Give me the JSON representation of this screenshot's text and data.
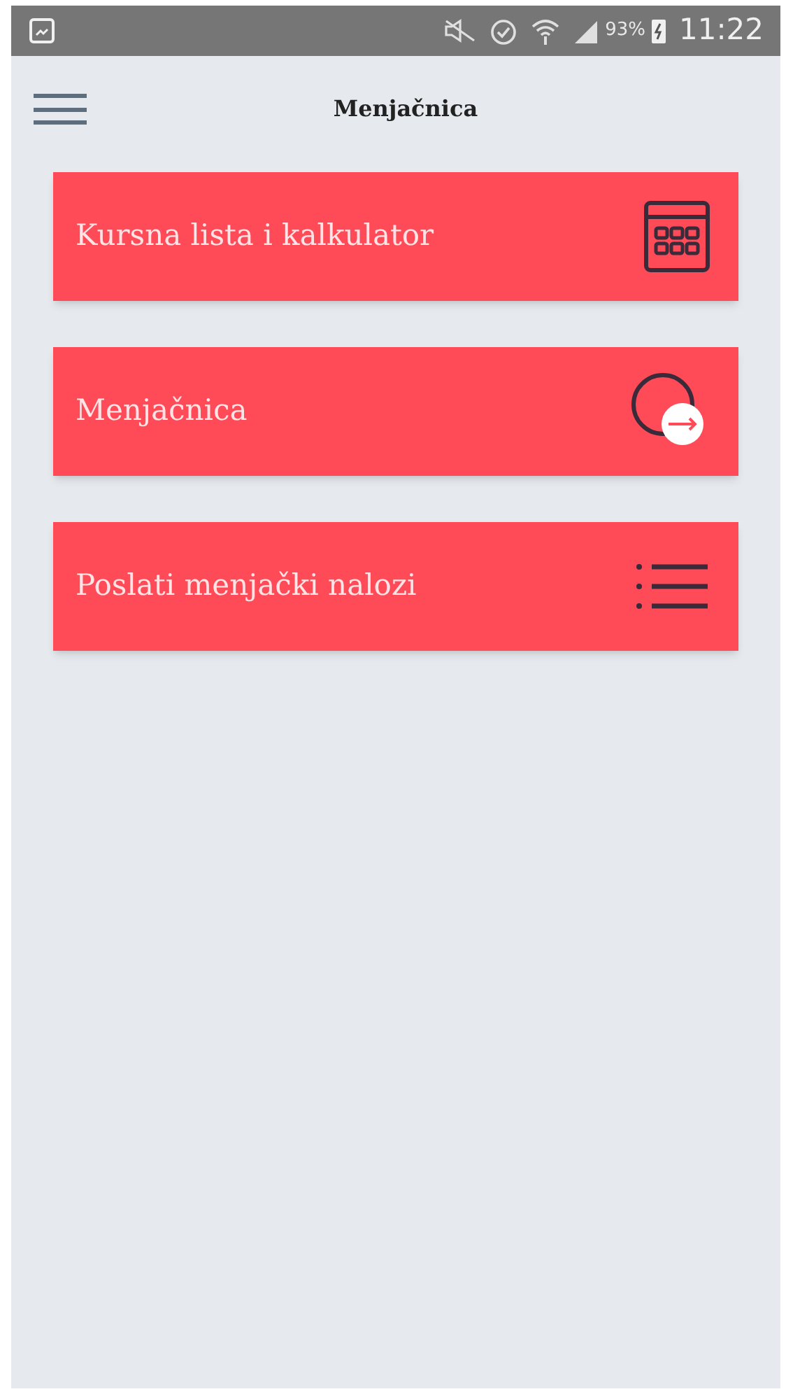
{
  "status_bar": {
    "battery": "93%",
    "time": "11:22"
  },
  "header": {
    "title": "Menjačnica"
  },
  "menu": [
    {
      "label": "Kursna lista i kalkulator",
      "kind": "calculator"
    },
    {
      "label": "Menjačnica",
      "kind": "exchange"
    },
    {
      "label": "Poslati menjački nalozi",
      "kind": "list"
    }
  ]
}
